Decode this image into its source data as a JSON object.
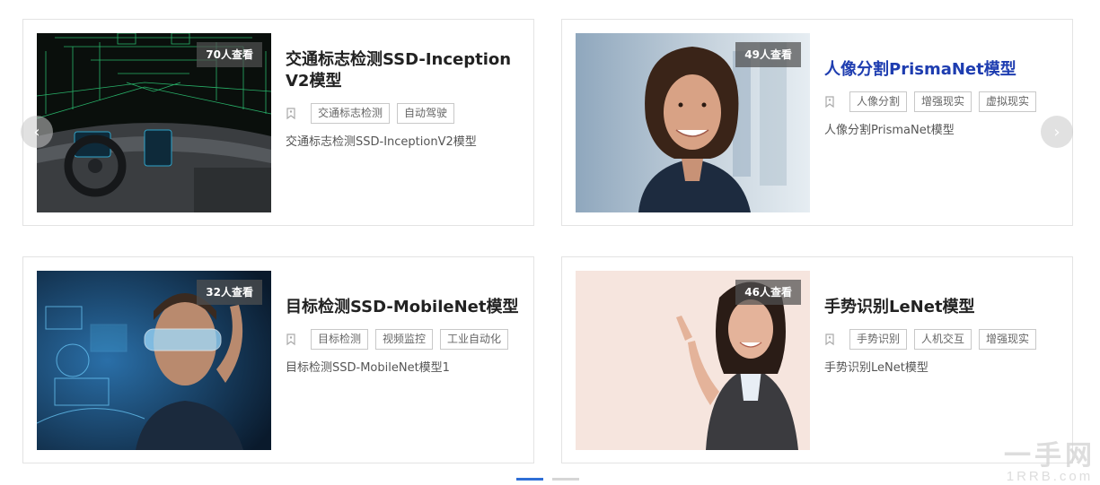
{
  "cards": [
    {
      "views": "70人查看",
      "title": "交通标志检测SSD-InceptionV2模型",
      "tags": [
        "交通标志检测",
        "自动驾驶"
      ],
      "desc": "交通标志检测SSD-InceptionV2模型"
    },
    {
      "views": "49人查看",
      "title": "人像分割PrismaNet模型",
      "tags": [
        "人像分割",
        "增强现实",
        "虚拟现实"
      ],
      "desc": "人像分割PrismaNet模型"
    },
    {
      "views": "32人查看",
      "title": "目标检测SSD-MobileNet模型",
      "tags": [
        "目标检测",
        "视频监控",
        "工业自动化"
      ],
      "desc": "目标检测SSD-MobileNet模型1"
    },
    {
      "views": "46人查看",
      "title": "手势识别LeNet模型",
      "tags": [
        "手势识别",
        "人机交互",
        "增强现实"
      ],
      "desc": "手势识别LeNet模型"
    }
  ],
  "nav": {
    "prev": "‹",
    "next": "›"
  },
  "pagination": {
    "active_page": 1,
    "total_pages": 2
  },
  "watermark": {
    "line1": "一手网",
    "line2": "1RRB.com"
  },
  "colors": {
    "active_title": "#1e3db0",
    "active_dot": "#2f6fd6"
  }
}
